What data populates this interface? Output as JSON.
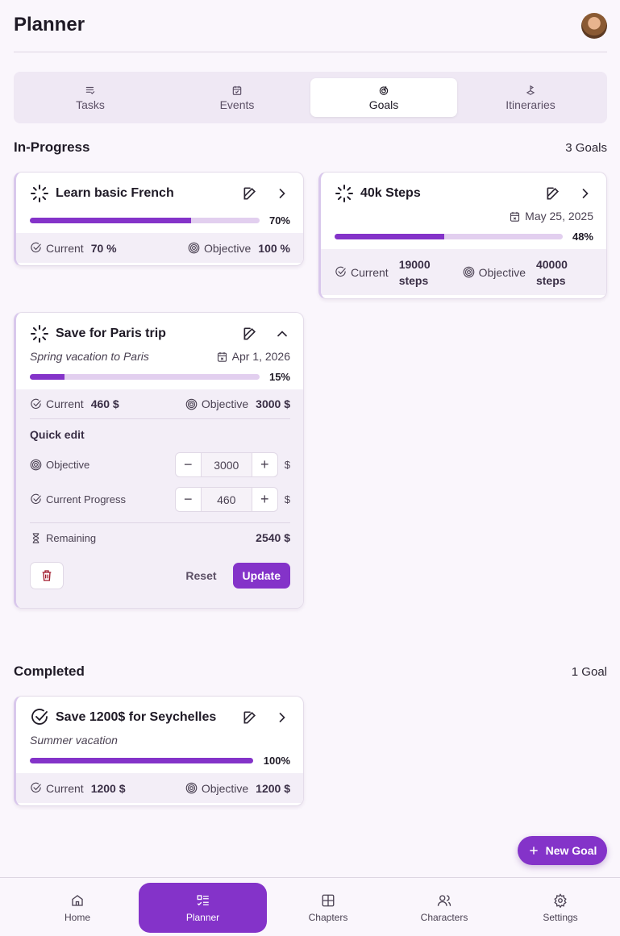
{
  "header": {
    "title": "Planner"
  },
  "tabs": [
    {
      "label": "Tasks",
      "icon": "list-check-icon"
    },
    {
      "label": "Events",
      "icon": "calendar-check-icon"
    },
    {
      "label": "Goals",
      "icon": "target-arrow-icon"
    },
    {
      "label": "Itineraries",
      "icon": "route-icon"
    }
  ],
  "in_progress": {
    "title": "In-Progress",
    "count": "3 Goals"
  },
  "completed": {
    "title": "Completed",
    "count": "1 Goal"
  },
  "goals": [
    {
      "name": "Learn basic French",
      "progress": 70,
      "progress_label": "70%",
      "current_label": "Current",
      "current": "70 %",
      "objective_label": "Objective",
      "objective": "100 %"
    },
    {
      "name": "40k Steps",
      "date": "May 25, 2025",
      "progress": 48,
      "progress_label": "48%",
      "current_label": "Current",
      "current_1": "19000",
      "current_2": "steps",
      "objective_label": "Objective",
      "objective_1": "40000",
      "objective_2": "steps"
    },
    {
      "name": "Save for Paris trip",
      "description": "Spring vacation to Paris",
      "date": "Apr 1, 2026",
      "progress": 15,
      "progress_label": "15%",
      "current_label": "Current",
      "current": "460 $",
      "objective_label": "Objective",
      "objective": "3000 $",
      "quick_edit": {
        "title": "Quick edit",
        "objective_label": "Objective",
        "objective_value": "3000",
        "current_label": "Current Progress",
        "current_value": "460",
        "unit": "$",
        "remaining_label": "Remaining",
        "remaining": "2540 $",
        "minus": "−",
        "plus": "+",
        "reset": "Reset",
        "update": "Update"
      }
    },
    {
      "name": "Save 1200$ for Seychelles",
      "description": "Summer vacation",
      "progress": 100,
      "progress_label": "100%",
      "current_label": "Current",
      "current": "1200 $",
      "objective_label": "Objective",
      "objective": "1200 $"
    }
  ],
  "fab": {
    "label": "New Goal"
  },
  "nav": [
    {
      "label": "Home"
    },
    {
      "label": "Planner"
    },
    {
      "label": "Chapters"
    },
    {
      "label": "Characters"
    },
    {
      "label": "Settings"
    }
  ],
  "colors": {
    "accent": "#8433c9",
    "track": "#e2cfef",
    "bg": "#faf6fc"
  }
}
